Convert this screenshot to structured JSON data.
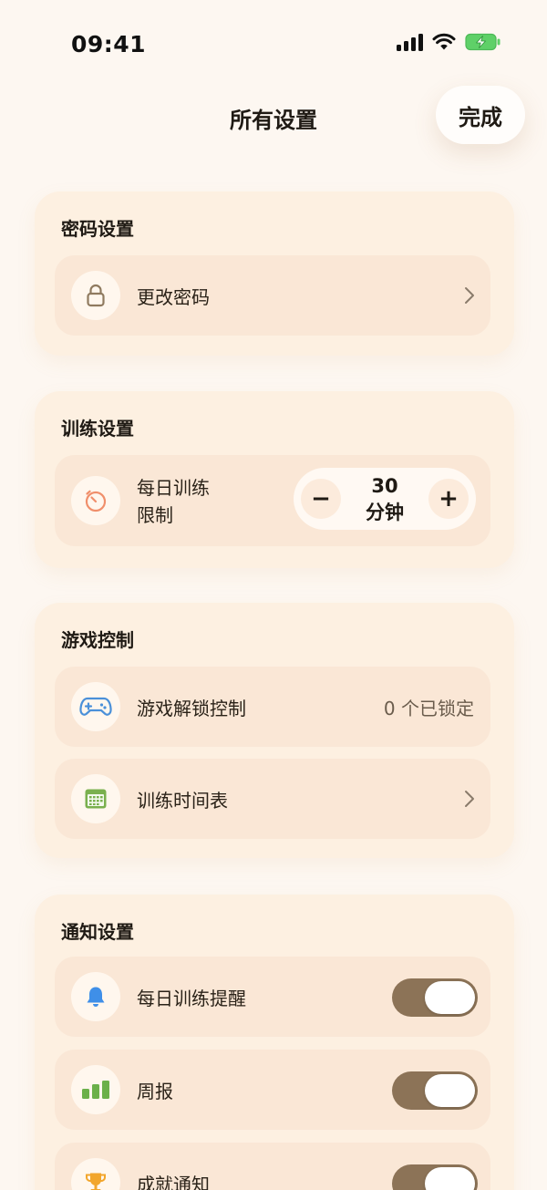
{
  "status_bar": {
    "time": "09:41"
  },
  "header": {
    "title": "所有设置",
    "done_label": "完成"
  },
  "sections": {
    "password": {
      "title": "密码设置",
      "change_password": {
        "label": "更改密码",
        "icon": "lock-icon"
      }
    },
    "training": {
      "title": "训练设置",
      "daily_limit": {
        "label_line1": "每日训练",
        "label_line2": "限制",
        "icon": "timer-icon",
        "value": "30",
        "unit": "分钟",
        "minus": "−",
        "plus": "+"
      }
    },
    "game": {
      "title": "游戏控制",
      "unlock": {
        "label": "游戏解锁控制",
        "value": "0 个已锁定",
        "icon": "gamepad-icon"
      },
      "schedule": {
        "label": "训练时间表",
        "icon": "calendar-icon"
      }
    },
    "notifications": {
      "title": "通知设置",
      "daily_reminder": {
        "label": "每日训练提醒",
        "icon": "bell-icon",
        "enabled": true
      },
      "weekly_report": {
        "label": "周报",
        "icon": "bar-chart-icon",
        "enabled": true
      },
      "achievements": {
        "label": "成就通知",
        "icon": "trophy-icon",
        "enabled": true
      }
    }
  },
  "colors": {
    "background": "#fdf7f1",
    "card": "#fdf0e1",
    "row": "#fae7d6",
    "toggle_on": "#8c7357",
    "lock": "#8f7a5f",
    "timer": "#f08f6b",
    "gamepad": "#4a90d9",
    "calendar": "#7ab04e",
    "bell": "#3f8fe8",
    "chart": "#6bb04a",
    "trophy": "#f2a62c"
  }
}
